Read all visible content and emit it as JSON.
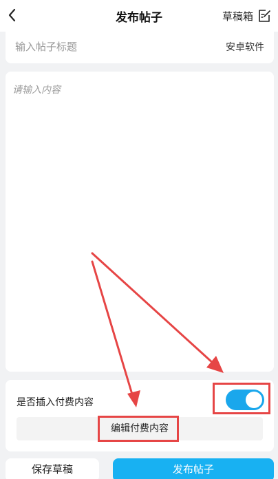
{
  "header": {
    "title": "发布帖子",
    "drafts_label": "草稿箱",
    "back_icon": "chevron-left-icon",
    "drafts_icon": "edit-note-icon"
  },
  "title_field": {
    "placeholder": "输入帖子标题",
    "value": "",
    "category": "安卓软件"
  },
  "content_field": {
    "placeholder": "请输入内容",
    "value": ""
  },
  "paid_section": {
    "label": "是否插入付费内容",
    "toggle_on": true,
    "edit_button": "编辑付费内容"
  },
  "footer": {
    "save_draft": "保存草稿",
    "publish": "发布帖子"
  },
  "colors": {
    "accent": "#18b1f2",
    "annotation": "#e64545"
  }
}
